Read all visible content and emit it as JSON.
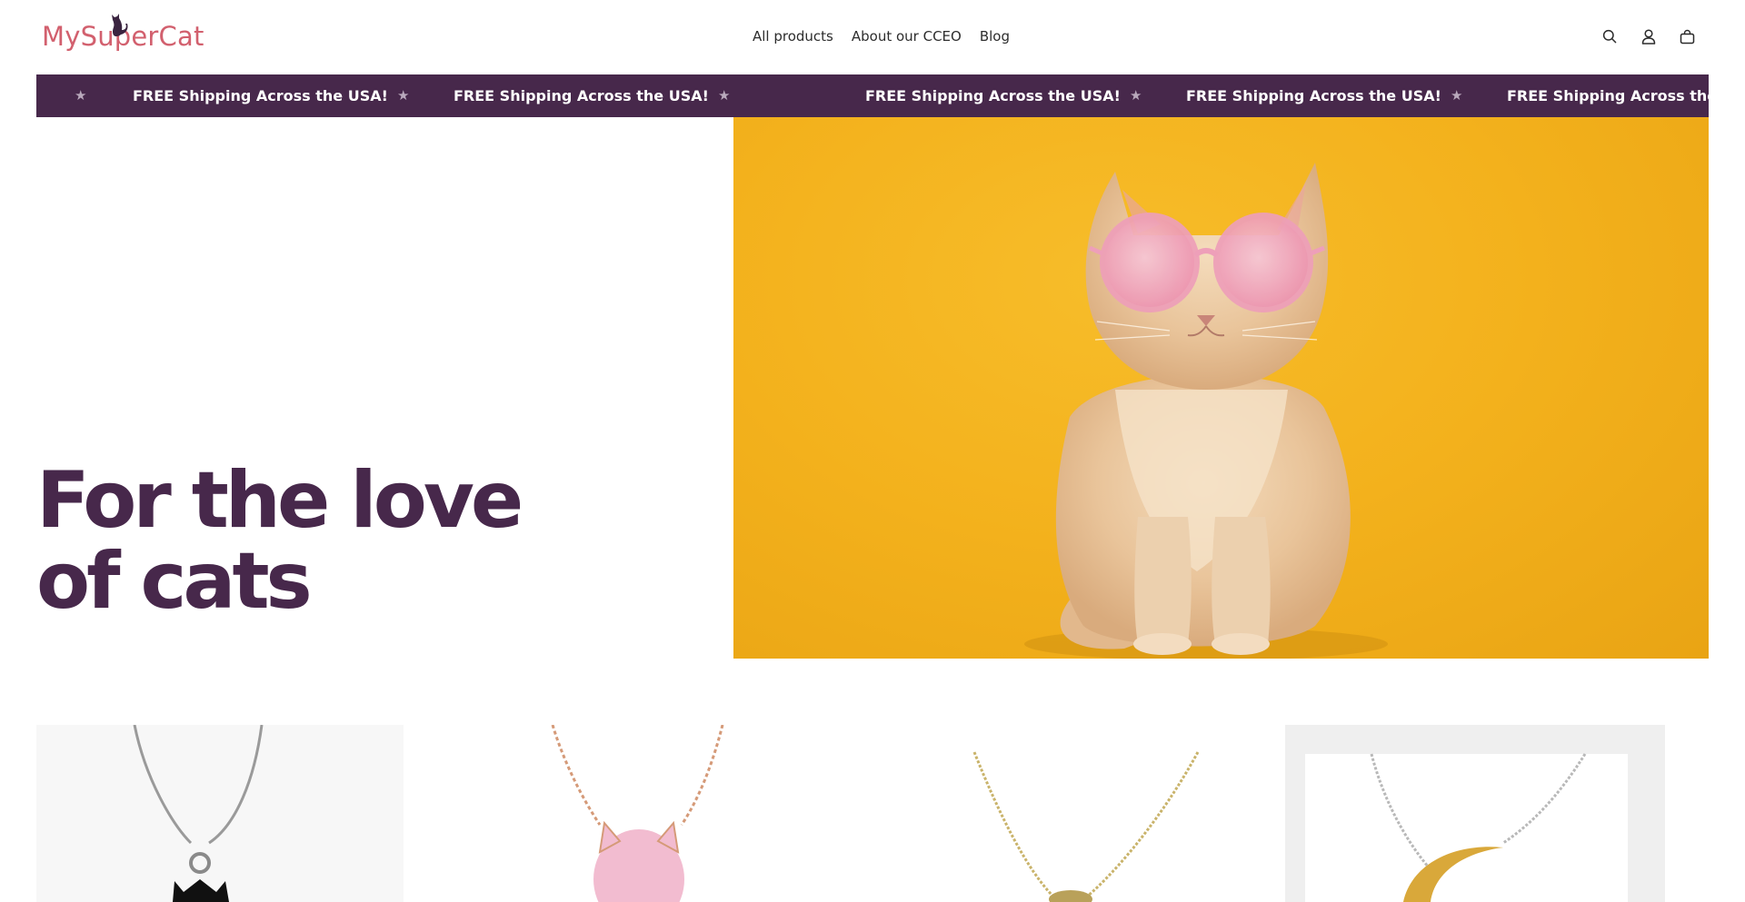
{
  "header": {
    "logo_text": "MySuperCat",
    "nav": [
      {
        "label": "All products"
      },
      {
        "label": "About our CCEO"
      },
      {
        "label": "Blog"
      }
    ],
    "icons": [
      "search-icon",
      "account-icon",
      "cart-icon"
    ]
  },
  "announcement": {
    "text": "FREE Shipping Across the USA!",
    "star": "★",
    "colors": {
      "background": "#47284b",
      "text": "#ffffff",
      "star": "#b9a9bc"
    }
  },
  "hero": {
    "title_line1": "For the love",
    "title_line2": "of cats",
    "image": "cat-with-pink-sunglasses-on-yellow-background",
    "colors": {
      "title": "#47284b",
      "image_bg": "#f3b11c"
    }
  },
  "products": [
    {
      "image": "black-cat-pendant-silver-necklace"
    },
    {
      "image": "pink-cat-pendant-rose-gold-necklace"
    },
    {
      "image": "gold-cat-pendant-necklace"
    },
    {
      "image": "gold-moon-cat-pendant-silver-necklace"
    }
  ],
  "colors": {
    "logo": "#d2606e",
    "brand_purple": "#47284b"
  }
}
